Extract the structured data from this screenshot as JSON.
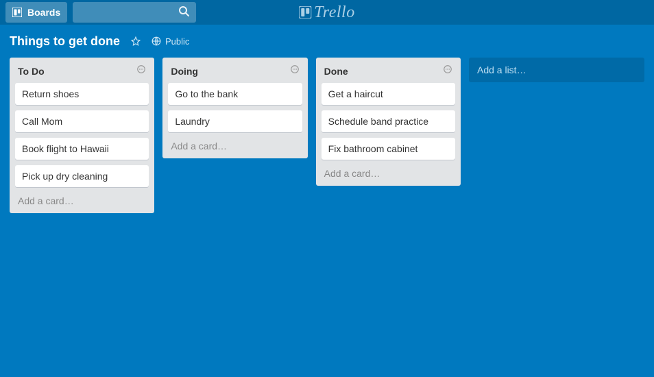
{
  "header": {
    "boards_label": "Boards",
    "brand_text": "Trello"
  },
  "board": {
    "title": "Things to get done",
    "visibility_label": "Public",
    "add_list_label": "Add a list…"
  },
  "lists": [
    {
      "name": "To Do",
      "cards": [
        "Return shoes",
        "Call Mom",
        "Book flight to Hawaii",
        "Pick up dry cleaning"
      ],
      "add_card_label": "Add a card…"
    },
    {
      "name": "Doing",
      "cards": [
        "Go to the bank",
        "Laundry"
      ],
      "add_card_label": "Add a card…"
    },
    {
      "name": "Done",
      "cards": [
        "Get a haircut",
        "Schedule band practice",
        "Fix bathroom cabinet"
      ],
      "add_card_label": "Add a card…"
    }
  ]
}
